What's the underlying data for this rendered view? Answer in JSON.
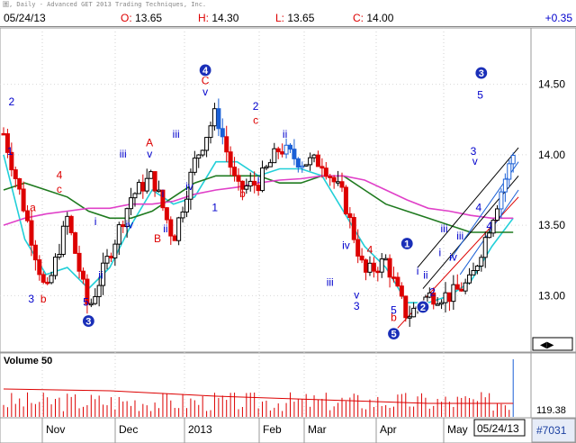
{
  "window": {
    "caption": "圖, Daily - Advanced GET 2013 Trading Techniques, Inc."
  },
  "quote": {
    "date": "05/24/13",
    "open_label": "O:",
    "open_value": "13.65",
    "high_label": "H:",
    "high_value": "14.30",
    "low_label": "L:",
    "low_value": "13.65",
    "close_label": "C:",
    "close_value": "14.00",
    "change": "+0.35"
  },
  "volume_panel": {
    "title": "Volume 50",
    "last_value": "119.38"
  },
  "footer": {
    "date_label": "05/24/13",
    "symbol_count": "#7031"
  },
  "colors": {
    "up_bar": "#000000",
    "down_bar": "#dd0000",
    "blue_bar": "#1a5fd6",
    "ma_fast": "#22cfd8",
    "ma_mid": "#1f7a1f",
    "ma_slow": "#e040c8",
    "wave_blue": "#0000cc",
    "wave_red": "#dd0000",
    "channel_black": "#000000",
    "channel_blue": "#1a5fd6",
    "channel_red": "#dd0000"
  },
  "chart_data": {
    "type": "candlestick",
    "title": "",
    "ylim": [
      12.6,
      14.9
    ],
    "y_ticks": [
      "14.50",
      "14.00",
      "13.50",
      "13.00"
    ],
    "x_labels": [
      "Nov",
      "Dec",
      "2013",
      "Feb",
      "Mar",
      "Apr",
      "May"
    ],
    "price_series": [
      {
        "x": 0,
        "close": 14.15
      },
      {
        "x": 4,
        "close": 13.6
      },
      {
        "x": 8,
        "close": 13.0
      },
      {
        "x": 12,
        "close": 13.55
      },
      {
        "x": 16,
        "close": 12.9
      },
      {
        "x": 20,
        "close": 13.3
      },
      {
        "x": 24,
        "close": 13.7
      },
      {
        "x": 28,
        "close": 13.85
      },
      {
        "x": 32,
        "close": 13.4
      },
      {
        "x": 36,
        "close": 13.95
      },
      {
        "x": 40,
        "close": 14.3
      },
      {
        "x": 44,
        "close": 13.75
      },
      {
        "x": 48,
        "close": 13.8
      },
      {
        "x": 52,
        "close": 14.05
      },
      {
        "x": 56,
        "close": 13.95
      },
      {
        "x": 60,
        "close": 13.95
      },
      {
        "x": 64,
        "close": 13.7
      },
      {
        "x": 68,
        "close": 13.15
      },
      {
        "x": 72,
        "close": 13.25
      },
      {
        "x": 76,
        "close": 12.85
      },
      {
        "x": 80,
        "close": 13.0
      },
      {
        "x": 84,
        "close": 13.0
      },
      {
        "x": 88,
        "close": 13.1
      },
      {
        "x": 92,
        "close": 13.55
      },
      {
        "x": 96,
        "close": 14.0
      }
    ],
    "series": [
      {
        "values": [
          14.0,
          13.4,
          13.15,
          13.2,
          13.05,
          13.2,
          13.5,
          13.75,
          13.65,
          13.7,
          13.95,
          13.95,
          13.85,
          13.9,
          13.9,
          13.85,
          13.6,
          13.35,
          13.2,
          12.95,
          12.95,
          13.0,
          13.1,
          13.35,
          13.55
        ]
      },
      {
        "values": [
          13.75,
          13.8,
          13.75,
          13.7,
          13.6,
          13.55,
          13.55,
          13.6,
          13.7,
          13.8,
          13.85,
          13.85,
          13.85,
          13.8,
          13.8,
          13.85,
          13.85,
          13.75,
          13.65,
          13.6,
          13.55,
          13.5,
          13.45,
          13.45,
          13.45
        ]
      },
      {
        "values": [
          13.5,
          13.55,
          13.58,
          13.6,
          13.62,
          13.62,
          13.65,
          13.65,
          13.67,
          13.72,
          13.75,
          13.77,
          13.8,
          13.82,
          13.83,
          13.85,
          13.85,
          13.82,
          13.75,
          13.68,
          13.62,
          13.6,
          13.57,
          13.55,
          13.55
        ]
      }
    ],
    "wave_labels": [
      {
        "text": "2",
        "x": 1.5,
        "y": 14.35,
        "color": "wave_blue"
      },
      {
        "text": "1",
        "x": 1.2,
        "y": 14.0,
        "color": "wave_blue"
      },
      {
        "text": "a",
        "x": 5.5,
        "y": 13.6,
        "color": "wave_red"
      },
      {
        "text": "4",
        "x": 10.5,
        "y": 13.83,
        "color": "wave_red"
      },
      {
        "text": "c",
        "x": 10.5,
        "y": 13.73,
        "color": "wave_red"
      },
      {
        "text": "3",
        "x": 5.2,
        "y": 12.95,
        "color": "wave_blue"
      },
      {
        "text": "b",
        "x": 7.5,
        "y": 12.95,
        "color": "wave_red"
      },
      {
        "text": "5",
        "x": 15.5,
        "y": 12.93,
        "color": "wave_blue"
      },
      {
        "text": "i",
        "x": 17.3,
        "y": 13.5,
        "color": "wave_blue"
      },
      {
        "text": "ii",
        "x": 18.3,
        "y": 13.12,
        "color": "wave_blue"
      },
      {
        "text": "iii",
        "x": 22.5,
        "y": 13.98,
        "color": "wave_blue"
      },
      {
        "text": "iv",
        "x": 23.7,
        "y": 13.48,
        "color": "wave_blue"
      },
      {
        "text": "A",
        "x": 27.5,
        "y": 14.06,
        "color": "wave_red"
      },
      {
        "text": "v",
        "x": 27.5,
        "y": 13.98,
        "color": "wave_blue"
      },
      {
        "text": "i",
        "x": 30.0,
        "y": 13.7,
        "color": "wave_blue"
      },
      {
        "text": "ii",
        "x": 30.5,
        "y": 13.45,
        "color": "wave_blue"
      },
      {
        "text": "B",
        "x": 29.0,
        "y": 13.38,
        "color": "wave_red"
      },
      {
        "text": "iii",
        "x": 32.5,
        "y": 14.12,
        "color": "wave_blue"
      },
      {
        "text": "iv",
        "x": 35.0,
        "y": 13.75,
        "color": "wave_blue"
      },
      {
        "text": "C",
        "x": 38.0,
        "y": 14.5,
        "color": "wave_red"
      },
      {
        "text": "v",
        "x": 38.0,
        "y": 14.42,
        "color": "wave_blue"
      },
      {
        "text": "1",
        "x": 39.8,
        "y": 13.6,
        "color": "wave_blue"
      },
      {
        "text": "b",
        "x": 45.0,
        "y": 13.7,
        "color": "wave_red"
      },
      {
        "text": "2",
        "x": 47.5,
        "y": 14.32,
        "color": "wave_blue"
      },
      {
        "text": "c",
        "x": 47.5,
        "y": 14.22,
        "color": "wave_red"
      },
      {
        "text": "i",
        "x": 48.0,
        "y": 13.8,
        "color": "wave_blue"
      },
      {
        "text": "ii",
        "x": 53.0,
        "y": 14.12,
        "color": "wave_blue"
      },
      {
        "text": "iii",
        "x": 61.5,
        "y": 13.07,
        "color": "wave_blue"
      },
      {
        "text": "iv",
        "x": 64.5,
        "y": 13.33,
        "color": "wave_blue"
      },
      {
        "text": "4",
        "x": 69.0,
        "y": 13.3,
        "color": "wave_red"
      },
      {
        "text": "v",
        "x": 66.5,
        "y": 12.98,
        "color": "wave_blue"
      },
      {
        "text": "3",
        "x": 66.5,
        "y": 12.9,
        "color": "wave_blue"
      },
      {
        "text": "5",
        "x": 73.5,
        "y": 12.87,
        "color": "wave_blue"
      },
      {
        "text": "b",
        "x": 73.5,
        "y": 12.82,
        "color": "wave_red"
      },
      {
        "text": "i",
        "x": 78.0,
        "y": 13.15,
        "color": "wave_blue"
      },
      {
        "text": "ii",
        "x": 79.5,
        "y": 13.12,
        "color": "wave_blue"
      },
      {
        "text": "2",
        "x": 80.8,
        "y": 13.0,
        "color": "wave_blue"
      },
      {
        "text": "iii",
        "x": 83.0,
        "y": 13.45,
        "color": "wave_blue"
      },
      {
        "text": "iv",
        "x": 84.7,
        "y": 13.25,
        "color": "wave_blue"
      },
      {
        "text": "i",
        "x": 82.2,
        "y": 13.28,
        "color": "wave_blue"
      },
      {
        "text": "iii",
        "x": 86.0,
        "y": 13.4,
        "color": "wave_blue"
      },
      {
        "text": "5",
        "x": 89.8,
        "y": 14.4,
        "color": "wave_blue"
      },
      {
        "text": "3",
        "x": 88.5,
        "y": 14.0,
        "color": "wave_blue"
      },
      {
        "text": "v",
        "x": 88.8,
        "y": 13.93,
        "color": "wave_blue"
      },
      {
        "text": "4",
        "x": 89.5,
        "y": 13.6,
        "color": "wave_blue"
      },
      {
        "text": "4",
        "x": 91.5,
        "y": 13.47,
        "color": "wave_blue"
      }
    ],
    "circled_labels": [
      {
        "text": "4",
        "x": 38.0,
        "y": 14.6
      },
      {
        "text": "3",
        "x": 16.0,
        "y": 12.82
      },
      {
        "text": "1",
        "x": 76.0,
        "y": 13.37
      },
      {
        "text": "2",
        "x": 79.0,
        "y": 12.92
      },
      {
        "text": "5",
        "x": 73.5,
        "y": 12.73
      },
      {
        "text": "3",
        "x": 90.0,
        "y": 14.58
      }
    ]
  }
}
